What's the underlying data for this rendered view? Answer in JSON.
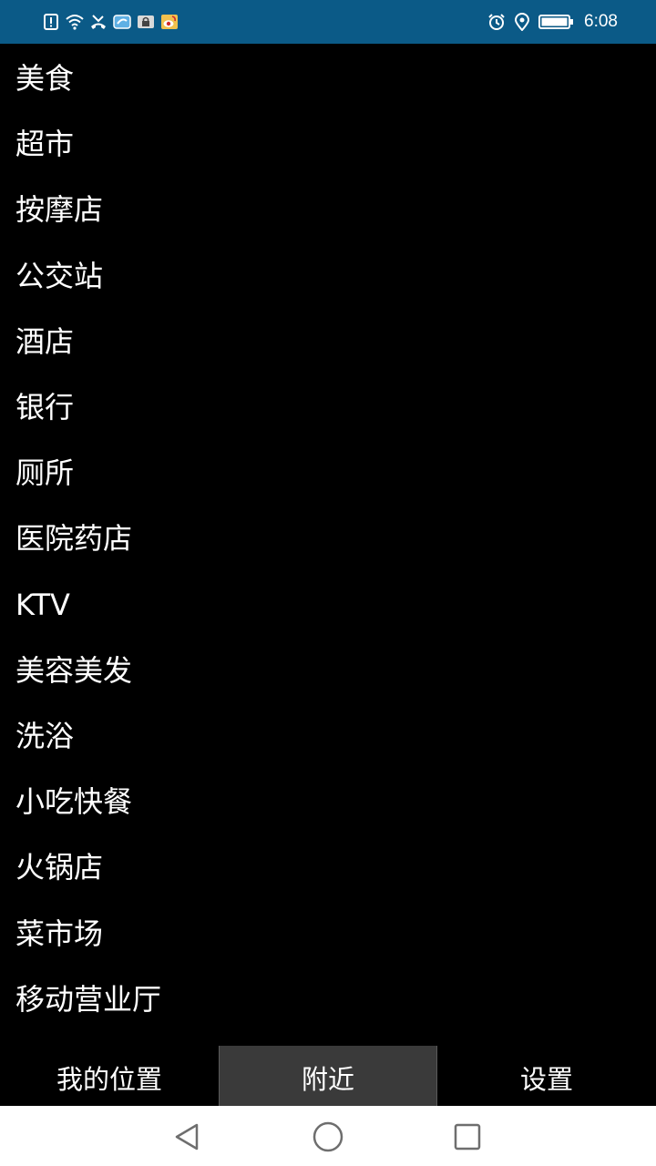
{
  "status_bar": {
    "time": "6:08",
    "left_icons": [
      "alert-icon",
      "wifi-icon",
      "missed-call-icon",
      "app-notification-icon",
      "lock-icon",
      "weibo-icon"
    ],
    "right_icons": [
      "alarm-icon",
      "location-icon",
      "battery-icon"
    ],
    "background_color": "#0b5a87"
  },
  "poi_list": {
    "items": [
      {
        "label": "美食"
      },
      {
        "label": "超市"
      },
      {
        "label": "按摩店"
      },
      {
        "label": "公交站"
      },
      {
        "label": "酒店"
      },
      {
        "label": "银行"
      },
      {
        "label": "厕所"
      },
      {
        "label": "医院药店"
      },
      {
        "label": "KTV"
      },
      {
        "label": "美容美发"
      },
      {
        "label": "洗浴"
      },
      {
        "label": "小吃快餐"
      },
      {
        "label": "火锅店"
      },
      {
        "label": "菜市场"
      },
      {
        "label": "移动营业厅"
      }
    ]
  },
  "tab_bar": {
    "tabs": [
      {
        "label": "我的位置",
        "active": false
      },
      {
        "label": "附近",
        "active": true
      },
      {
        "label": "设置",
        "active": false
      }
    ],
    "active_color": "#3a3a3a"
  },
  "nav_bar": {
    "buttons": [
      "back-icon",
      "home-icon",
      "recents-icon"
    ]
  }
}
